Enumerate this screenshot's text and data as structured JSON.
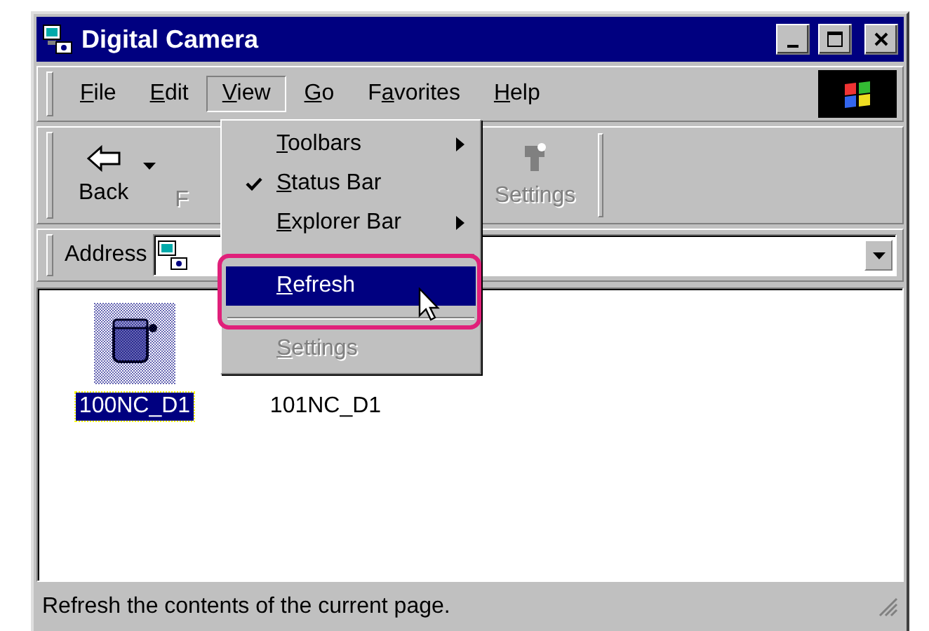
{
  "window": {
    "title": "Digital Camera"
  },
  "menu_bar": [
    {
      "accel": "F",
      "rest": "ile",
      "selected": false
    },
    {
      "accel": "E",
      "rest": "dit",
      "selected": false
    },
    {
      "accel": "V",
      "rest": "iew",
      "selected": true
    },
    {
      "accel": "G",
      "rest": "o",
      "selected": false
    },
    {
      "lead": "F",
      "accel": "a",
      "rest": "vorites",
      "selected": false
    },
    {
      "accel": "H",
      "rest": "elp",
      "selected": false
    }
  ],
  "toolbar": {
    "back": {
      "label": "Back"
    },
    "forward": {
      "label": "F"
    },
    "settings": {
      "label": "Settings",
      "disabled": true
    }
  },
  "address_bar": {
    "label": "Address"
  },
  "view_menu": [
    {
      "kind": "submenu",
      "accel": "T",
      "rest": "oolbars",
      "checked": false,
      "disabled": false,
      "selected": false
    },
    {
      "kind": "item",
      "accel": "S",
      "rest": "tatus Bar",
      "checked": true,
      "disabled": false,
      "selected": false
    },
    {
      "kind": "submenu",
      "accel": "E",
      "rest": "xplorer Bar",
      "checked": false,
      "disabled": false,
      "selected": false
    },
    {
      "kind": "separator"
    },
    {
      "kind": "item",
      "accel": "R",
      "rest": "efresh",
      "checked": false,
      "disabled": false,
      "selected": true
    },
    {
      "kind": "separator"
    },
    {
      "kind": "item",
      "accel": "S",
      "rest": "ettings",
      "checked": false,
      "disabled": true,
      "selected": false
    }
  ],
  "folders": [
    {
      "name": "100NC_D1",
      "selected": true
    },
    {
      "name": "101NC_D1",
      "selected": false
    }
  ],
  "status_bar": {
    "text": "Refresh the contents of the current page."
  }
}
